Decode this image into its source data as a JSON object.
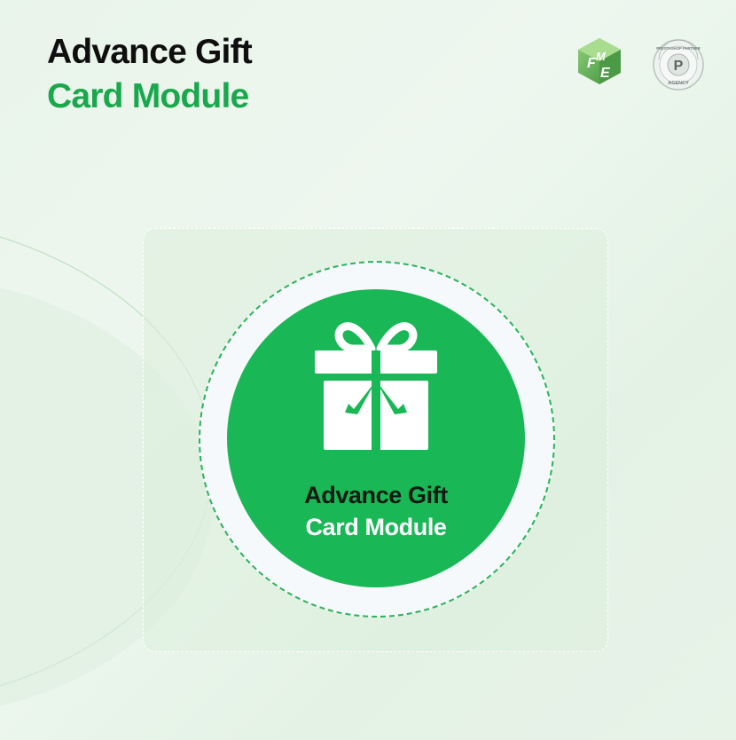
{
  "header": {
    "title_line1": "Advance Gift",
    "title_line2": "Card Module"
  },
  "logos": {
    "fme": {
      "icon": "fme-logo-icon",
      "text": "FME"
    },
    "partner_badge": {
      "icon": "prestashop-partner-badge-icon",
      "text_top": "PRESTASHOP PARTNER",
      "text_bottom": "AGENCY",
      "letter": "P"
    }
  },
  "product_badge": {
    "icon": "gift-box-icon",
    "line1": "Advance Gift",
    "line2": "Card Module"
  },
  "colors": {
    "accent_green": "#1aa84d",
    "disc_green": "#1ab756",
    "title_dark": "#0f0f0f",
    "background": "#e9f4ea"
  }
}
